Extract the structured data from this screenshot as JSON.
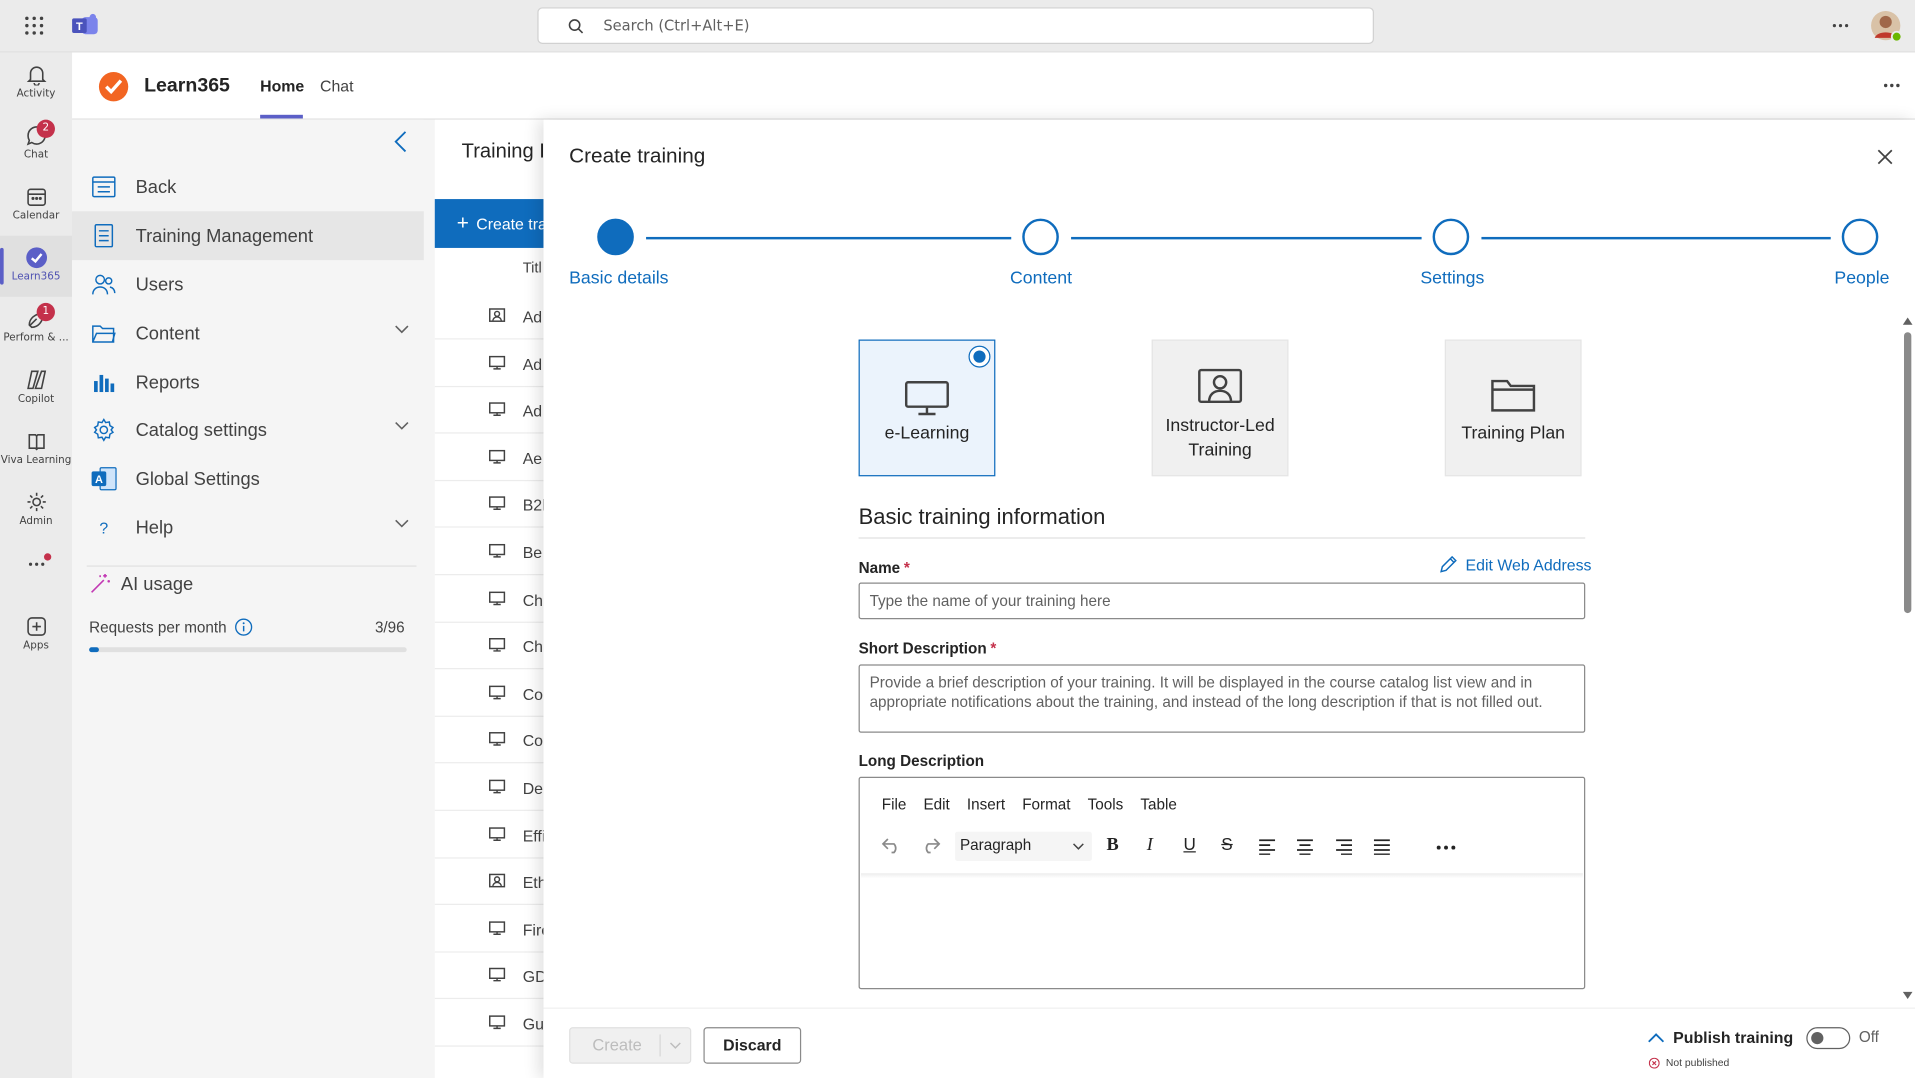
{
  "topbar": {
    "search_placeholder": "Search (Ctrl+Alt+E)"
  },
  "rail": {
    "items": [
      {
        "label": "Activity",
        "icon": "bell-icon"
      },
      {
        "label": "Chat",
        "icon": "chat-icon",
        "badge": "2"
      },
      {
        "label": "Calendar",
        "icon": "calendar-icon"
      },
      {
        "label": "Learn365",
        "icon": "learn365-icon"
      },
      {
        "label": "Perform & ...",
        "icon": "perform-icon",
        "badge": "1"
      },
      {
        "label": "Copilot",
        "icon": "copilot-icon"
      },
      {
        "label": "Viva Learning",
        "icon": "viva-icon"
      },
      {
        "label": "Admin",
        "icon": "admin-icon"
      },
      {
        "label": "Apps",
        "icon": "apps-icon"
      }
    ]
  },
  "app": {
    "name": "Learn365",
    "tabs": [
      "Home",
      "Chat"
    ],
    "active_tab": "Home"
  },
  "nav": {
    "items": [
      {
        "label": "Back"
      },
      {
        "label": "Training Management"
      },
      {
        "label": "Users"
      },
      {
        "label": "Content"
      },
      {
        "label": "Reports"
      },
      {
        "label": "Catalog settings"
      },
      {
        "label": "Global Settings"
      },
      {
        "label": "Help"
      }
    ],
    "ai_usage": "AI usage",
    "requests_label": "Requests per month",
    "requests_value": "3/96",
    "requests_fraction": 0.031
  },
  "list": {
    "heading": "Training I",
    "create_label": "Create tra",
    "column": "Titl",
    "rows": [
      "Ad",
      "Ad",
      "Ad",
      "Ae",
      "B2l",
      "Be",
      "Ch",
      "Ch",
      "Co",
      "Co",
      "De",
      "Effi",
      "Eth",
      "Fire",
      "GD",
      "Gu"
    ]
  },
  "dialog": {
    "title": "Create training",
    "steps": [
      "Basic details",
      "Content",
      "Settings",
      "People"
    ],
    "types": [
      {
        "label": "e-Learning",
        "icon": "monitor-icon",
        "selected": true
      },
      {
        "label": "Instructor-Led Training",
        "icon": "presenter-icon"
      },
      {
        "label": "Training Plan",
        "icon": "folder-icon"
      }
    ],
    "section_title": "Basic training information",
    "name_label": "Name",
    "edit_web_address": "Edit Web Address",
    "name_placeholder": "Type the name of your training here",
    "short_desc_label": "Short Description",
    "short_desc_placeholder": "Provide a brief description of your training. It will be displayed in the course catalog list view and in appropriate notifications about the training, and instead of the long description if that is not filled out.",
    "long_desc_label": "Long Description",
    "editor_menu": [
      "File",
      "Edit",
      "Insert",
      "Format",
      "Tools",
      "Table"
    ],
    "paragraph": "Paragraph",
    "create_button": "Create",
    "discard_button": "Discard",
    "publish_label": "Publish training",
    "toggle_state": "Off",
    "publish_status": "Not published",
    "accent": "#0f6cbd"
  }
}
